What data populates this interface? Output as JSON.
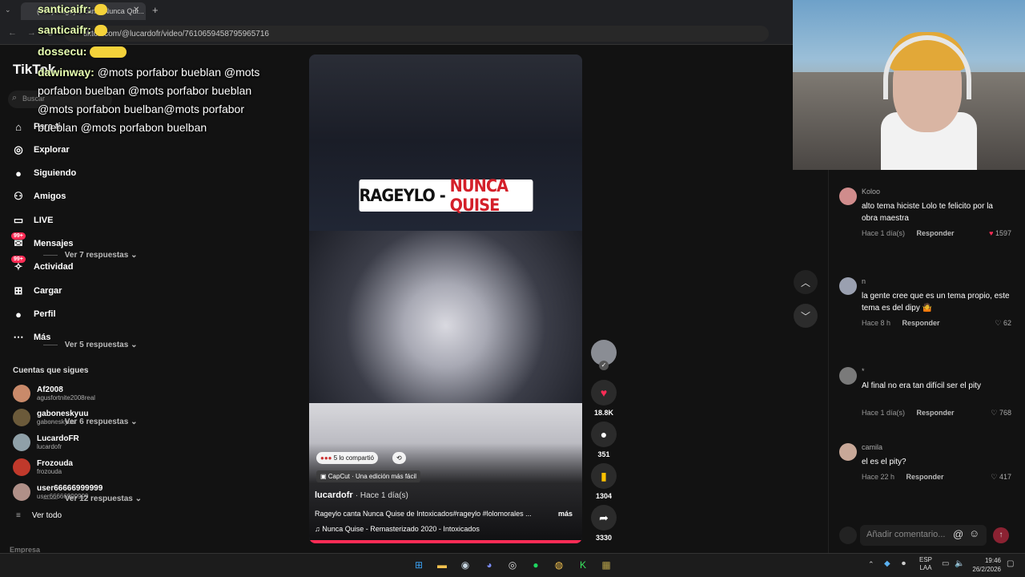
{
  "browser": {
    "tab_title": "(99+) Rageylo canta Nunca Qui...",
    "url": "tiktok.com/@lucardofr/video/7610659458795965716"
  },
  "chat": [
    {
      "name": "santicaifr:",
      "message": ""
    },
    {
      "name": "santicaifr:",
      "message": ""
    },
    {
      "name": "dossecu:",
      "message": ""
    },
    {
      "name": "dawinway:",
      "message": "@mots porfabor bueblan @mots porfabon buelban @mots porfabor bueblan @mots porfabon buelban@mots porfabor bueblan @mots porfabon buelban"
    }
  ],
  "sidebar": {
    "logo": "TikTok",
    "search_placeholder": "Buscar",
    "items": [
      {
        "label": "Para ti",
        "icon": "home-icon"
      },
      {
        "label": "Explorar",
        "icon": "compass-icon"
      },
      {
        "label": "Siguiendo",
        "icon": "avatar-icon"
      },
      {
        "label": "Amigos",
        "icon": "friends-icon"
      },
      {
        "label": "LIVE",
        "icon": "live-icon"
      },
      {
        "label": "Mensajes",
        "icon": "message-icon",
        "badge": "99+"
      },
      {
        "label": "Actividad",
        "icon": "bell-icon",
        "badge": "99+"
      },
      {
        "label": "Cargar",
        "icon": "plus-icon"
      },
      {
        "label": "Perfil",
        "icon": "profile-icon"
      },
      {
        "label": "Más",
        "icon": "more-icon"
      }
    ],
    "following_title": "Cuentas que sigues",
    "following": [
      {
        "name": "Af2008",
        "user": "agusfortnite2008real",
        "color": "#c98a6a"
      },
      {
        "name": "gaboneskyuu",
        "user": "gaboneskyuu",
        "color": "#6b5a3a"
      },
      {
        "name": "LucardoFR",
        "user": "lucardofr",
        "color": "#8fa0a8"
      },
      {
        "name": "Frozouda",
        "user": "frozouda",
        "color": "#c0392b"
      },
      {
        "name": "user66666999999",
        "user": "user66666999999",
        "color": "#b09088"
      }
    ],
    "see_all": "Ver todo",
    "footer": "Empresa"
  },
  "video": {
    "title_left": "RAGEYLO - ",
    "title_right": "NUNCA QUISE",
    "shared": "5 lo compartió",
    "capcut": "CapCut · Una edición más fácil",
    "author": "lucardofr",
    "time": "· Hace 1 día(s)",
    "description": "Rageylo canta Nunca Quise de Intoxicados#rageylo #lolomorales ...",
    "more": "más",
    "music": "Nunca Quise - Remasterizado 2020 - Intoxicados"
  },
  "actions": {
    "likes": "18.8K",
    "comments": "351",
    "saves": "1304",
    "shares": "3330"
  },
  "comments": [
    {
      "user": "Koloo",
      "text": "alto tema hiciste Lolo te felicito por la obra maestra",
      "time": "Hace 1 día(s)",
      "reply": "Responder",
      "likes": "1597",
      "liked": true,
      "more": "Ver 7 respuestas",
      "color": "#d08c8c"
    },
    {
      "user": "n",
      "text": "la gente cree que es un tema propio, este tema es del dipy 🤷",
      "time": "Hace 8 h",
      "reply": "Responder",
      "likes": "62",
      "liked": false,
      "more": "Ver 5 respuestas",
      "color": "#9aa0b0"
    },
    {
      "user": "*",
      "text": "Al final no era tan difícil ser el pity",
      "time": "Hace 1 día(s)",
      "reply": "Responder",
      "likes": "768",
      "liked": false,
      "more": "Ver 6 respuestas",
      "color": "#7a7a7a"
    },
    {
      "user": "camila",
      "text": "el es el pity?",
      "time": "Hace 22 h",
      "reply": "Responder",
      "likes": "417",
      "liked": false,
      "more": "Ver 12 respuestas",
      "color": "#c8a898"
    }
  ],
  "comment_input": {
    "placeholder": "Añadir comentario..."
  },
  "taskbar": {
    "lang1": "ESP",
    "lang2": "LAA",
    "time": "19:46",
    "date": "26/2/2026"
  }
}
